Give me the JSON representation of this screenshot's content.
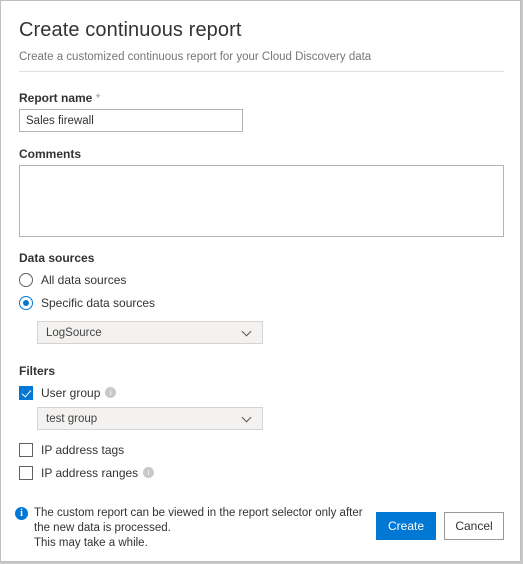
{
  "dialog": {
    "title": "Create continuous report",
    "subtitle": "Create a customized continuous report for your Cloud Discovery data"
  },
  "report_name": {
    "label": "Report name",
    "required_marker": "*",
    "value": "Sales firewall",
    "placeholder": ""
  },
  "comments": {
    "label": "Comments",
    "value": "",
    "placeholder": ""
  },
  "data_sources": {
    "label": "Data sources",
    "options": [
      {
        "label": "All data sources",
        "selected": false
      },
      {
        "label": "Specific data sources",
        "selected": true
      }
    ],
    "dropdown": {
      "value": "LogSource",
      "icon": "chevron-down-icon"
    }
  },
  "filters": {
    "label": "Filters",
    "items": [
      {
        "label": "User group",
        "checked": true,
        "info": true
      },
      {
        "label": "IP address tags",
        "checked": false,
        "info": false
      },
      {
        "label": "IP address ranges",
        "checked": false,
        "info": true
      }
    ],
    "user_group_dropdown": {
      "value": "test group",
      "icon": "chevron-down-icon"
    }
  },
  "footer": {
    "info_icon": "info-icon",
    "note_line_1": "The custom report can be viewed in the report selector only after the new",
    "note_line_2": "data is processed.",
    "note_line_3": "This may take a while.",
    "create_label": "Create",
    "cancel_label": "Cancel"
  },
  "colors": {
    "accent": "#0078d4",
    "text": "#333333",
    "muted": "#767676",
    "border": "#b3b3b3",
    "dropdown_bg": "#f3f2f1"
  }
}
